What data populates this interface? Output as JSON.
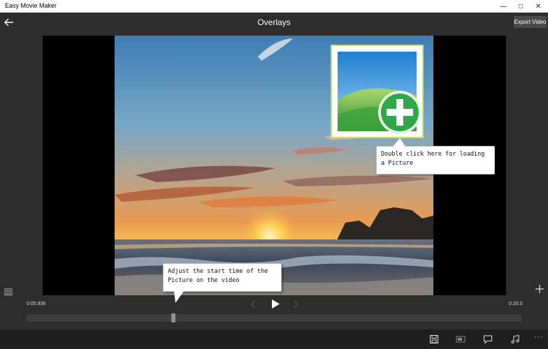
{
  "window": {
    "title": "Easy Movie Maker",
    "controls": {
      "minimize": "—",
      "maximize": "□",
      "close": "✕"
    }
  },
  "header": {
    "title": "Overlays",
    "back_icon": "back-arrow-icon",
    "export_label": "Export Video"
  },
  "callouts": {
    "picture": "Double click here for loading a Picture",
    "start_time": "Adjust the start time of the Picture on the video"
  },
  "playback": {
    "current_time": "0:05.936",
    "total_time": "0:20.0",
    "position_fraction": 0.297
  },
  "bottom_bar": {
    "icons": [
      "save-icon",
      "overlay-icon",
      "caption-icon",
      "music-icon"
    ],
    "more_label": "···"
  },
  "colors": {
    "background": "#2d2d2d",
    "picture_border": "#cde06a",
    "add_button": "#2ea84a"
  }
}
